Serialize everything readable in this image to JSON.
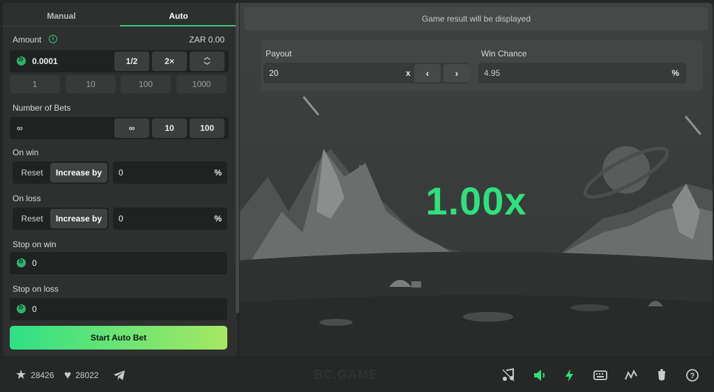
{
  "tabs": {
    "manual": "Manual",
    "auto": "Auto"
  },
  "amount": {
    "label": "Amount",
    "info_icon": "info-icon",
    "balance": "ZAR 0.00",
    "value": "0.0001",
    "half": "1/2",
    "double": "2×",
    "presets": [
      "1",
      "10",
      "100",
      "1000"
    ]
  },
  "bets": {
    "label": "Number of Bets",
    "value": "∞",
    "options": [
      "∞",
      "10",
      "100"
    ]
  },
  "on_win": {
    "label": "On win",
    "reset": "Reset",
    "increase": "Increase by",
    "value": "0",
    "unit": "%"
  },
  "on_loss": {
    "label": "On loss",
    "reset": "Reset",
    "increase": "Increase by",
    "value": "0",
    "unit": "%"
  },
  "stop_win": {
    "label": "Stop on win",
    "value": "0"
  },
  "stop_loss": {
    "label": "Stop on loss",
    "value": "0"
  },
  "start_button": "Start Auto Bet",
  "game": {
    "result_text": "Game result will be displayed",
    "payout_label": "Payout",
    "payout_value": "20",
    "payout_unit": "x",
    "win_chance_label": "Win Chance",
    "win_chance_value": "4.95",
    "win_chance_unit": "%",
    "multiplier": "1.00x"
  },
  "footer": {
    "favorites": "28426",
    "likes": "28022",
    "brand": "BC.GAME",
    "icons": [
      "music-icon",
      "speaker-icon",
      "lightning-icon",
      "keyboard-icon",
      "chart-icon",
      "fairness-icon",
      "help-icon"
    ]
  },
  "colors": {
    "accent": "#2ee17e",
    "panel": "#2d302f",
    "field": "#1f2221"
  }
}
